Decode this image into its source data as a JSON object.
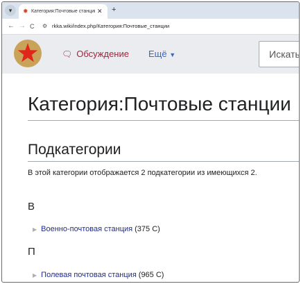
{
  "browser": {
    "tab_title": "Категория:Почтовые станции",
    "url": "rkka.wiki/index.php/Категория:Почтовые_станции",
    "menu_icon": "chevron-down-icon",
    "favicon": "star-icon",
    "close_glyph": "✕",
    "new_tab_glyph": "+",
    "back_glyph": "←",
    "forward_glyph": "→",
    "reload_glyph": "C",
    "site_info_glyph": "⚙"
  },
  "header": {
    "discussion_label": "Обсуждение",
    "more_label": "Ещё",
    "search_placeholder": "Искать",
    "accent_color": "#a2253a",
    "link_color": "#3366cc"
  },
  "page": {
    "title": "Категория:Почтовые станции",
    "subcategories_heading": "Подкатегории",
    "subcategories_text": "В этой категории отображается 2 подкатегории из имеющихся 2.",
    "groups": [
      {
        "letter": "В",
        "items": [
          {
            "label": "Военно-почтовая станция",
            "count": "(375 С)"
          }
        ]
      },
      {
        "letter": "П",
        "items": [
          {
            "label": "Полевая почтовая станция",
            "count": "(965 С)"
          }
        ]
      }
    ]
  }
}
